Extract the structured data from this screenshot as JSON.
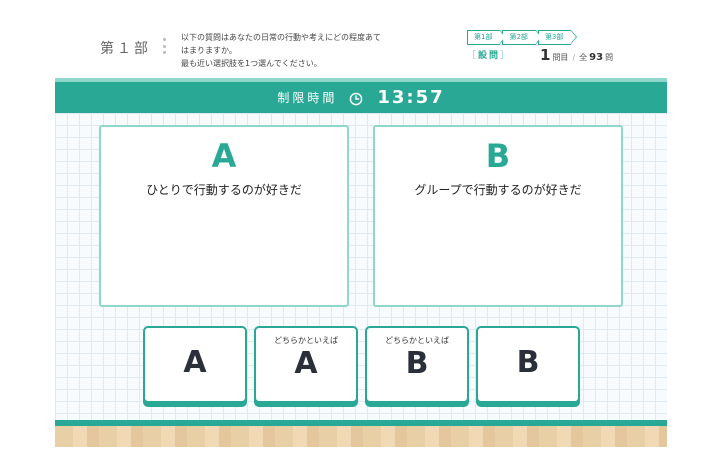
{
  "header": {
    "section_title": "第１部",
    "instructions": [
      "以下の質問はあなたの日常の行動や考えにどの程度あて",
      "はまりますか。",
      "最も近い選択肢を1つ選んでください。"
    ],
    "steps": [
      "第1部",
      "第2部",
      "第3部"
    ],
    "question_label": "設問",
    "question_current": "1",
    "question_unit": "問目",
    "question_total_prefix": "全",
    "question_total": "93",
    "question_total_unit": "問"
  },
  "timer": {
    "label": "制限時間",
    "icon": "clock-icon",
    "value": "13:57"
  },
  "options": [
    {
      "letter": "A",
      "text": "ひとりで行動するのが好きだ"
    },
    {
      "letter": "B",
      "text": "グループで行動するのが好きだ"
    }
  ],
  "answers": [
    {
      "sub": "",
      "letter": "A"
    },
    {
      "sub": "どちらかといえば",
      "letter": "A"
    },
    {
      "sub": "どちらかといえば",
      "letter": "B"
    },
    {
      "sub": "",
      "letter": "B"
    }
  ],
  "colors": {
    "accent": "#2aa896",
    "accent_light": "#8fd6cc",
    "grid_line": "#dfe9f1",
    "wood": "#e9cfa6"
  }
}
